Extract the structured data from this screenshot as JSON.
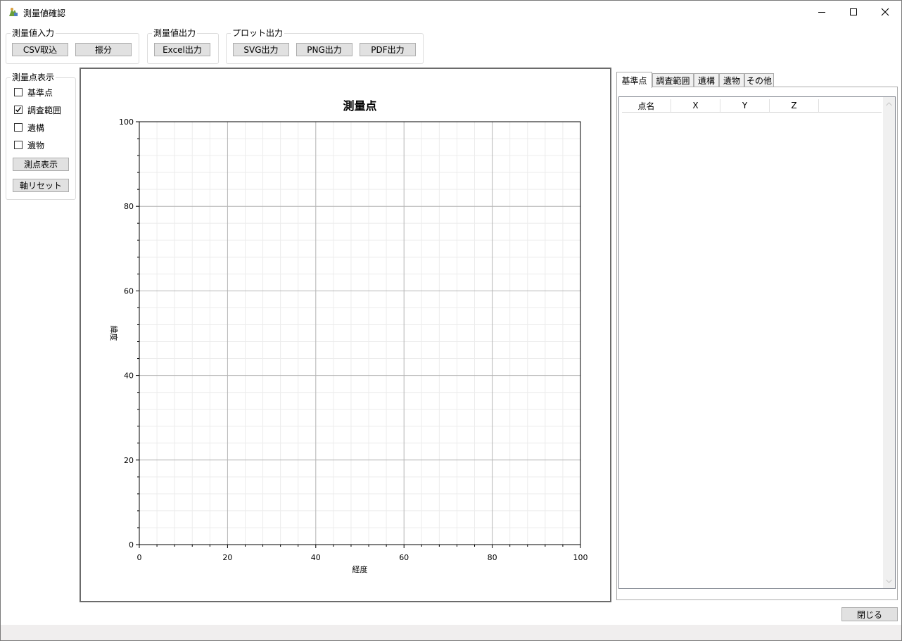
{
  "window": {
    "title": "測量値確認"
  },
  "groups": {
    "input": {
      "label": "測量値入力",
      "buttons": [
        "CSV取込",
        "振分"
      ]
    },
    "output": {
      "label": "測量値出力",
      "buttons": [
        "Excel出力"
      ]
    },
    "plot_output": {
      "label": "プロット出力",
      "buttons": [
        "SVG出力",
        "PNG出力",
        "PDF出力"
      ]
    },
    "display": {
      "label": "測量点表示",
      "checkboxes": [
        {
          "label": "基準点",
          "checked": false
        },
        {
          "label": "調査範囲",
          "checked": true
        },
        {
          "label": "遺構",
          "checked": false
        },
        {
          "label": "遺物",
          "checked": false
        }
      ],
      "buttons": [
        "測点表示",
        "軸リセット"
      ]
    }
  },
  "chart_data": {
    "type": "scatter",
    "title": "測量点",
    "xlabel": "経度",
    "ylabel": "緯度",
    "xlim": [
      0,
      100
    ],
    "ylim": [
      0,
      100
    ],
    "x_ticks": [
      0,
      20,
      40,
      60,
      80,
      100
    ],
    "y_ticks": [
      0,
      20,
      40,
      60,
      80,
      100
    ],
    "minor_step": 4,
    "grid": true,
    "series": []
  },
  "tabs": [
    "基準点",
    "調査範囲",
    "遺構",
    "遺物",
    "その他"
  ],
  "active_tab": 0,
  "table": {
    "columns": [
      "点名",
      "X",
      "Y",
      "Z"
    ],
    "rows": []
  },
  "footer": {
    "close_label": "閉じる"
  }
}
